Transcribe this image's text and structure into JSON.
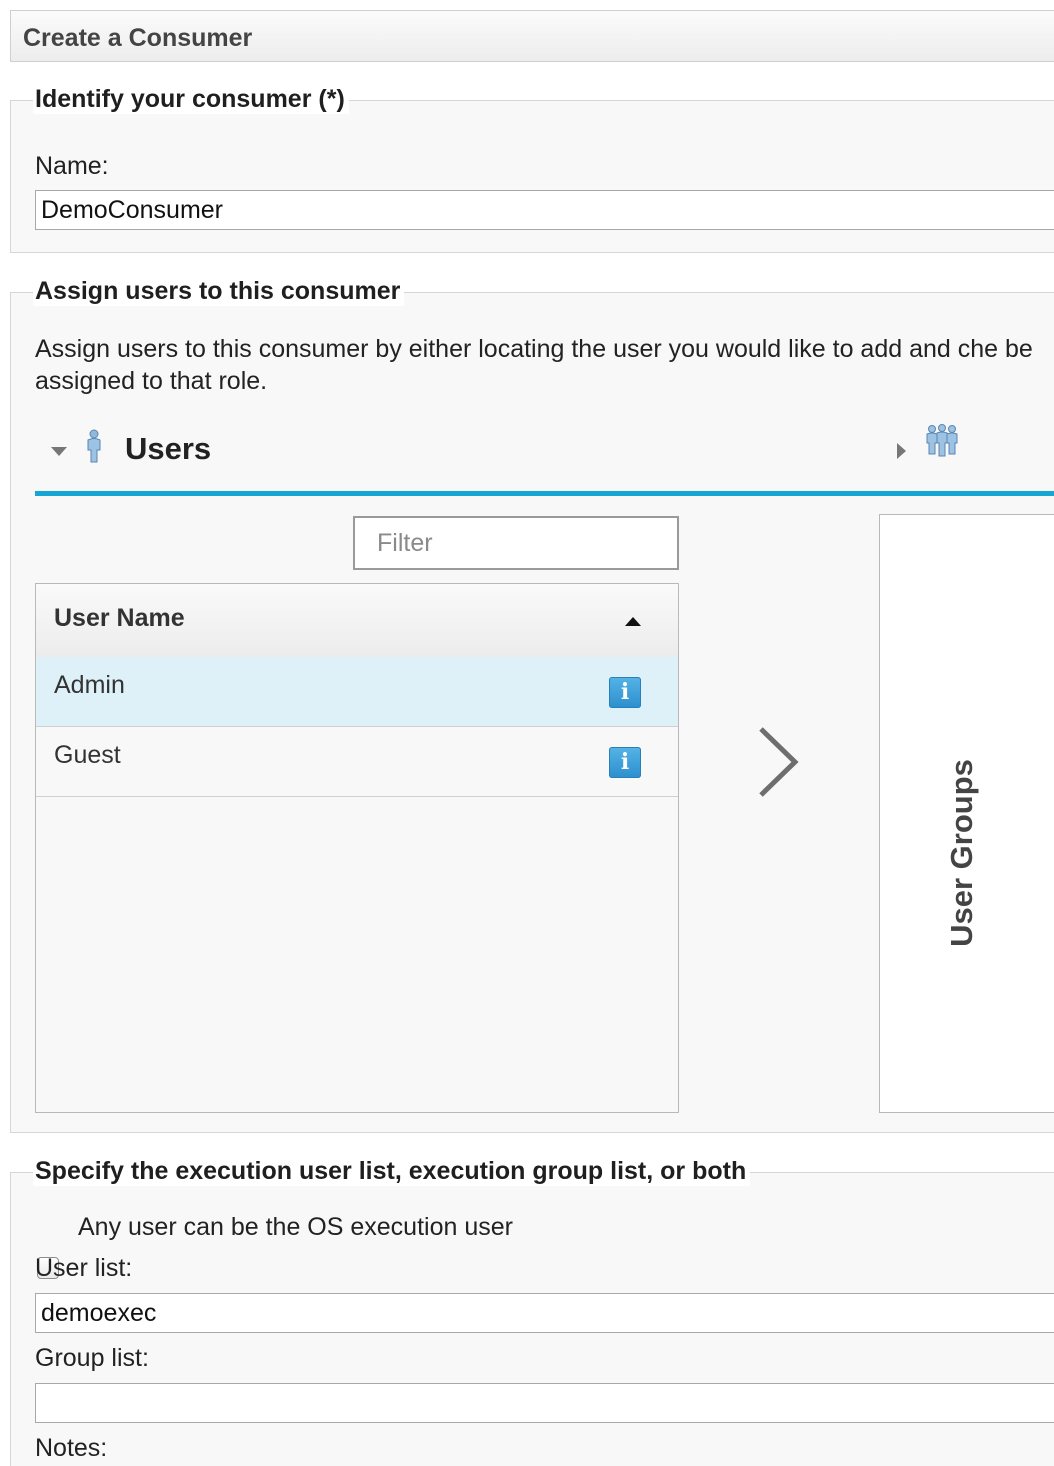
{
  "header": {
    "title": "Create a Consumer"
  },
  "identify": {
    "legend": "Identify your consumer  (*)",
    "name_label": "Name:",
    "name_value": "DemoConsumer"
  },
  "assign": {
    "legend": "Assign users to this consumer",
    "description": "Assign users to this consumer by either locating the user you would like to add and che be assigned to that role.",
    "users_tab": {
      "label": "Users",
      "icon": "user-icon",
      "expanded": true
    },
    "groups_tab": {
      "icon": "user-group-icon",
      "expanded": false
    },
    "filter": {
      "placeholder": "Filter",
      "value": ""
    },
    "table": {
      "column_header": "User Name",
      "sort": "ascending",
      "rows": [
        {
          "label": "Admin",
          "selected": true,
          "icon": "info-icon"
        },
        {
          "label": "Guest",
          "selected": false,
          "icon": "info-icon"
        }
      ]
    },
    "add_arrow_icon": "chevron-right-icon",
    "groups_panel_label": "User Groups"
  },
  "execution": {
    "legend": "Specify the execution user list, execution group list, or both",
    "any_user_checkbox_label": "Any user can be the OS execution user",
    "any_user_checked": false,
    "user_list_label": "User list:",
    "user_list_value": "demoexec",
    "group_list_label": "Group list:",
    "group_list_value": "",
    "notes_label": "Notes:"
  },
  "colors": {
    "accent": "#16a6d4",
    "selected_row": "#def1f8",
    "info_icon": "#2c8fce"
  }
}
